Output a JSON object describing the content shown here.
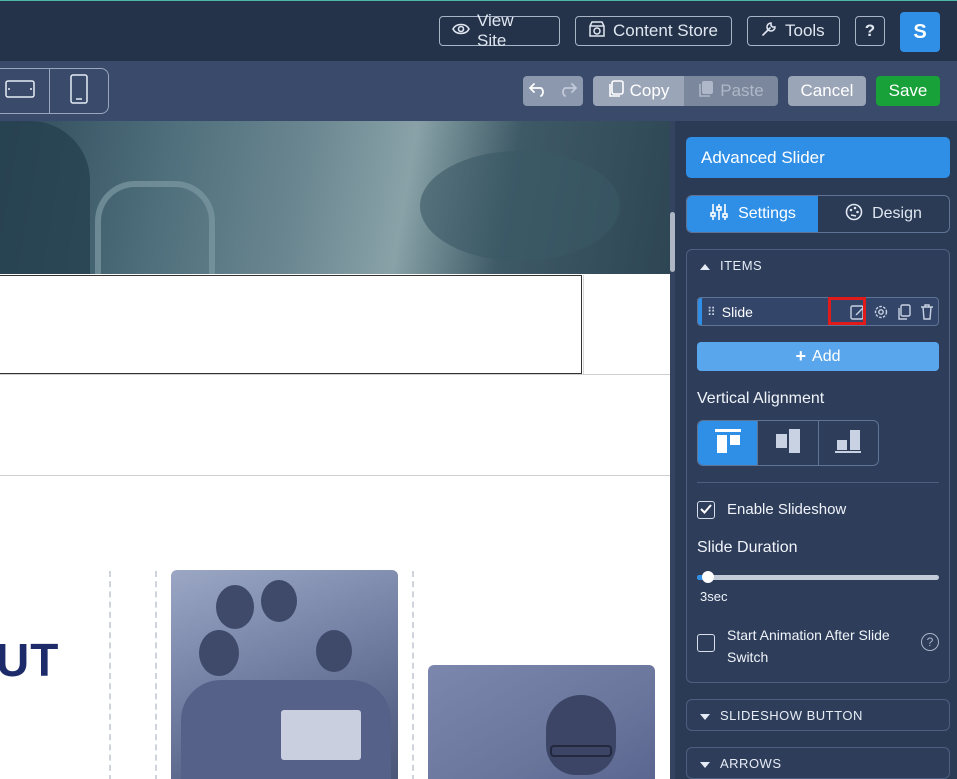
{
  "topbar": {
    "view_site": "View Site",
    "content_store": "Content Store",
    "tools": "Tools",
    "help": "?",
    "avatar": "S"
  },
  "toolbar": {
    "copy": "Copy",
    "paste": "Paste",
    "cancel": "Cancel",
    "save": "Save"
  },
  "canvas": {
    "heading_fragment": "UT"
  },
  "panel": {
    "title": "Advanced Slider",
    "tabs": [
      {
        "label": "Settings",
        "active": true
      },
      {
        "label": "Design",
        "active": false
      }
    ],
    "items_section": {
      "header": "ITEMS",
      "items": [
        {
          "label": "Slide"
        }
      ],
      "add_label": "Add"
    },
    "vertical_alignment_label": "Vertical Alignment",
    "enable_slideshow": {
      "label": "Enable Slideshow",
      "checked": true
    },
    "slide_duration": {
      "label": "Slide Duration",
      "value": "3sec"
    },
    "start_animation": {
      "label_line1": "Start Animation After Slide",
      "label_line2": "Switch",
      "checked": false
    },
    "help_icon_text": "?",
    "slideshow_button_header": "SLIDESHOW BUTTON",
    "arrows_header": "ARROWS"
  },
  "colors": {
    "accent": "#2f8fe6",
    "save": "#17a138",
    "highlight": "#e11a1a"
  }
}
